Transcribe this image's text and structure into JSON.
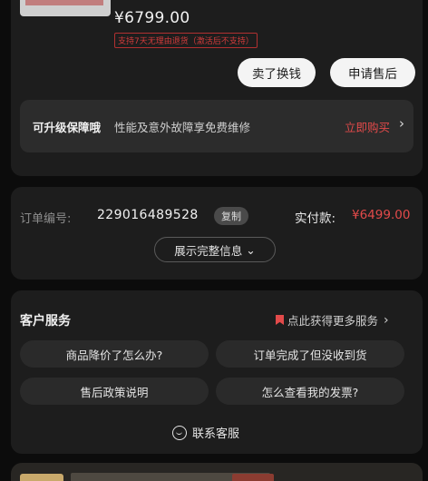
{
  "product": {
    "price": "¥6799.00",
    "return_policy_tag": "支持7天无理由退货（激活后不支持）",
    "sell_button": "卖了换钱",
    "after_sales_button": "申请售后"
  },
  "warranty": {
    "title": "可升级保障哦",
    "description": "性能及意外故障享免费维修",
    "buy_link": "立即购买",
    "chevron": "›"
  },
  "order": {
    "number_label": "订单编号:",
    "number_value": "229016489528",
    "copy_button": "复制",
    "paid_label": "实付款:",
    "paid_amount": "¥6499.00",
    "expand_button": "展示完整信息",
    "expand_chevron": "⌄"
  },
  "service": {
    "title": "客户服务",
    "more_link": "点此获得更多服务",
    "more_chevron": "›",
    "questions": [
      "商品降价了怎么办?",
      "订单完成了但没收到货",
      "售后政策说明",
      "怎么查看我的发票?"
    ],
    "contact_button": "联系客服"
  },
  "colors": {
    "accent_red": "#e24a4a",
    "card_bg": "#1d1d1d",
    "page_bg": "#0c0c0c"
  }
}
